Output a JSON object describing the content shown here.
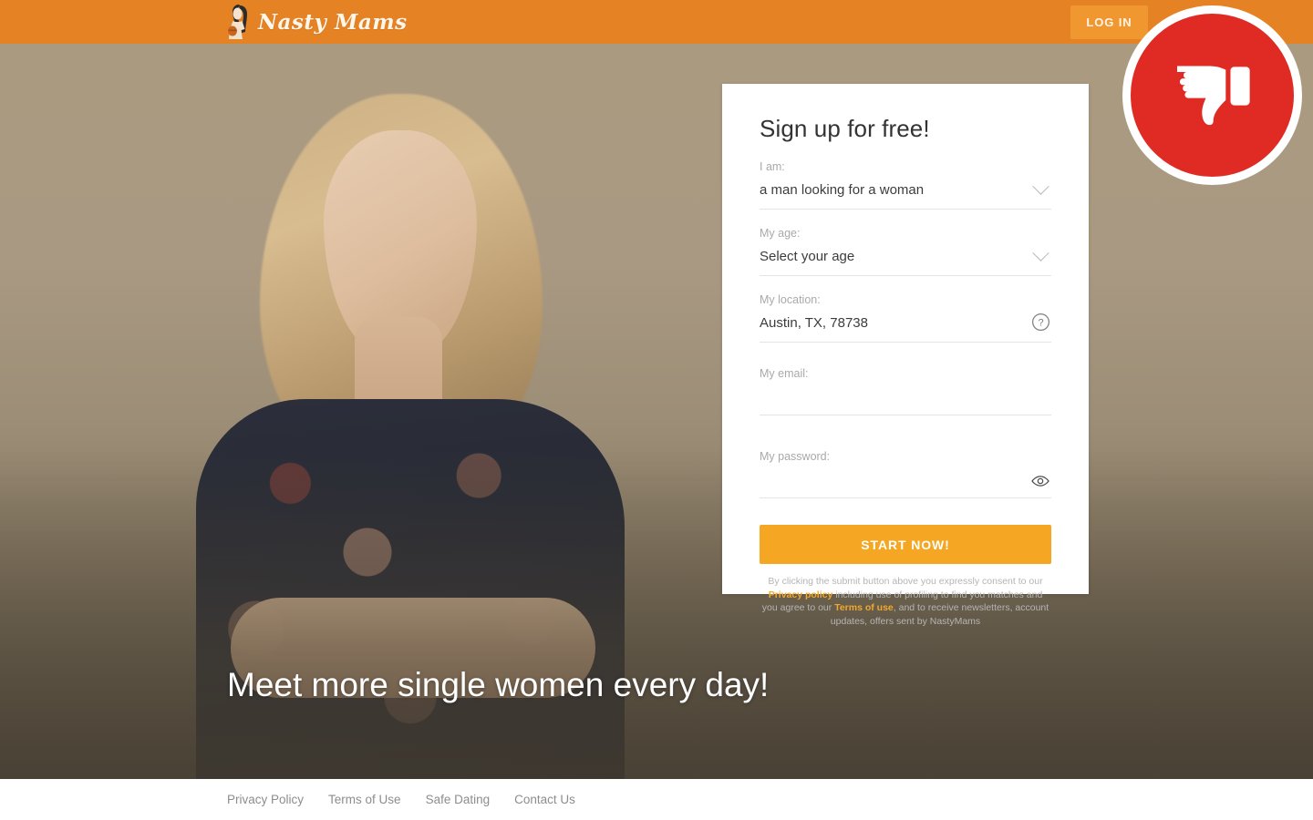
{
  "header": {
    "logo_text": "Nasty Mams",
    "logo_icon": "woman-illustration-icon",
    "login_label": "LOG IN"
  },
  "badge": {
    "icon": "thumbs-down-icon",
    "circle_color": "#e02b25",
    "ring_color": "#ffffff"
  },
  "hero": {
    "headline": "Meet more single women every day!",
    "background_top_color": "#aa9a80",
    "background_bottom_color": "#574e41"
  },
  "signup": {
    "title": "Sign up for free!",
    "fields": [
      {
        "label": "I am:",
        "value": "a man looking for a woman",
        "icon": "chevron-down-icon",
        "name": "gender-preference"
      },
      {
        "label": "My age:",
        "value": "Select your age",
        "icon": "chevron-down-icon",
        "name": "age"
      },
      {
        "label": "My location:",
        "value": "Austin, TX, 78738",
        "icon": "question-mark-icon",
        "name": "location"
      },
      {
        "label": "My email:",
        "value": "",
        "icon": "",
        "name": "email"
      },
      {
        "label": "My password:",
        "value": "",
        "icon": "eye-icon",
        "name": "password"
      }
    ],
    "submit_label": "START NOW!",
    "submit_color": "#f5a623",
    "disclaimer": {
      "part1": "By clicking the submit button above you expressly consent to our ",
      "link1": "Privacy policy",
      "part2": " including use of profiling to find you matches and you agree to our ",
      "link2": "Terms of use",
      "part3": ", and to receive newsletters, account updates, offers sent by NastyMams",
      "link_color": "#f0a830"
    }
  },
  "footer": {
    "links": [
      {
        "label": "Privacy Policy"
      },
      {
        "label": "Terms of Use"
      },
      {
        "label": "Safe Dating"
      },
      {
        "label": "Contact Us"
      }
    ]
  },
  "colors": {
    "header_orange": "#e58223",
    "login_orange": "#f0982f",
    "accent_amber": "#f5a623",
    "badge_red": "#e02b25"
  }
}
